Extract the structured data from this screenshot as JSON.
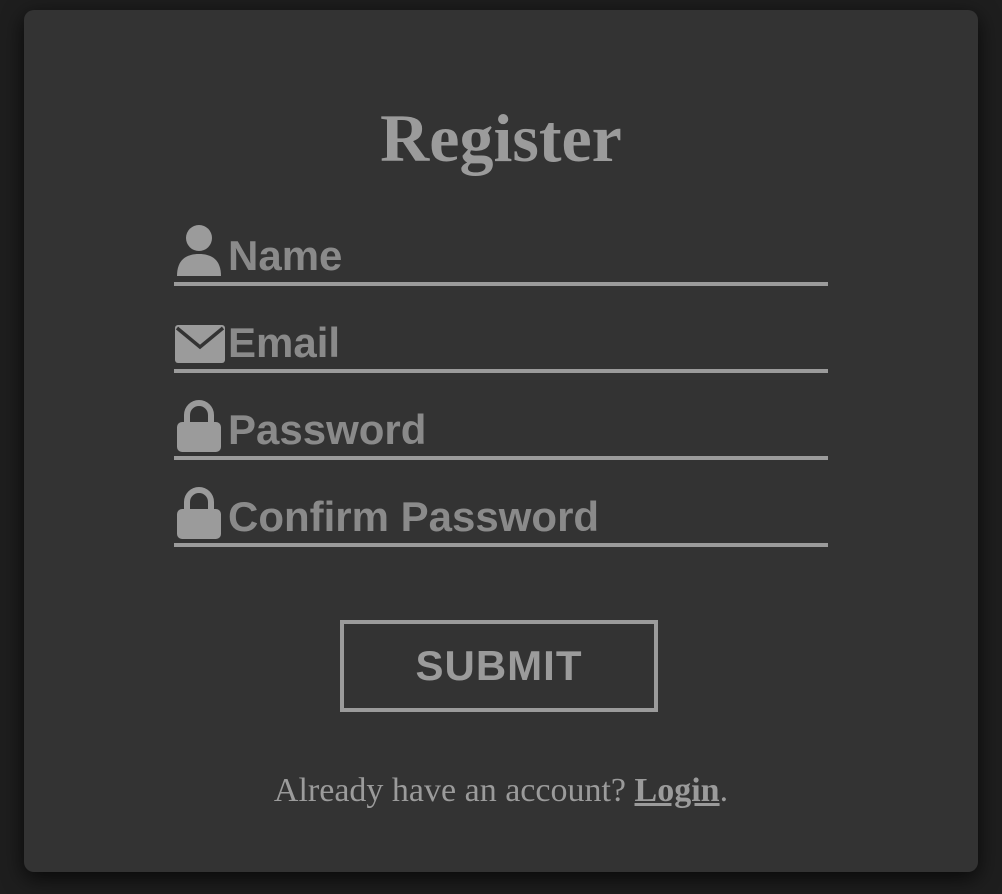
{
  "form": {
    "title": "Register",
    "fields": [
      {
        "icon": "user-icon",
        "placeholder": "Name",
        "value": ""
      },
      {
        "icon": "envelope-icon",
        "placeholder": "Email",
        "value": ""
      },
      {
        "icon": "lock-icon",
        "placeholder": "Password",
        "value": ""
      },
      {
        "icon": "lock-icon",
        "placeholder": "Confirm Password",
        "value": ""
      }
    ],
    "submit_label": "SUBMIT",
    "footer": {
      "prefix": "Already have an account? ",
      "link_label": "Login",
      "suffix": "."
    }
  },
  "colors": {
    "background": "#1e1e1e",
    "card": "#333333",
    "foreground": "#9b9b9b"
  }
}
